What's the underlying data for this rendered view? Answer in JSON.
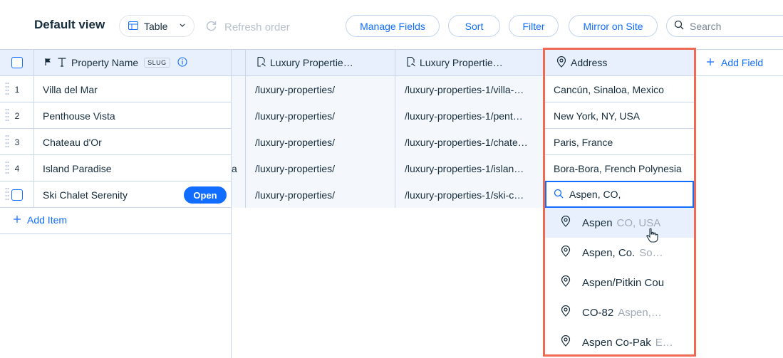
{
  "toolbar": {
    "title": "Default view",
    "view_select": "Table",
    "refresh": "Refresh order",
    "manage_fields": "Manage Fields",
    "sort": "Sort",
    "filter": "Filter",
    "mirror": "Mirror on Site",
    "search_placeholder": "Search"
  },
  "columns": {
    "property_name": "Property Name",
    "slug_badge": "SLUG",
    "luxury1": "Luxury Propertie…",
    "luxury2": "Luxury Propertie…",
    "address": "Address",
    "add_field": "Add Field"
  },
  "rows": [
    {
      "num": "1",
      "name": "Villa del Mar",
      "link1": "/luxury-properties/",
      "link2": "/luxury-properties-1/villa-…",
      "address": "Cancún, Sinaloa, Mexico"
    },
    {
      "num": "2",
      "name": "Penthouse Vista",
      "link1": "/luxury-properties/",
      "link2": "/luxury-properties-1/pent…",
      "address": "New York, NY, USA"
    },
    {
      "num": "3",
      "name": "Chateau d'Or",
      "link1": "/luxury-properties/",
      "link2": "/luxury-properties-1/chate…",
      "address": "Paris, France"
    },
    {
      "num": "4",
      "name": "Island Paradise",
      "link1": "/luxury-properties/",
      "link2": "/luxury-properties-1/islan…",
      "address": "Bora-Bora, French Polynesia",
      "fragment": "a"
    },
    {
      "name": "Ski Chalet Serenity",
      "link1": "/luxury-properties/",
      "link2": "/luxury-properties-1/ski-c…",
      "open": "Open"
    }
  ],
  "add_item": "Add Item",
  "address_input": "Aspen, CO,",
  "suggestions": [
    {
      "main": "Aspen",
      "sub": "CO, USA"
    },
    {
      "main": "Aspen, Co.",
      "sub": "So…"
    },
    {
      "main": "Aspen/Pitkin Cou",
      "sub": ""
    },
    {
      "main": "CO-82",
      "sub": "Aspen,…"
    },
    {
      "main": "Aspen Co-Pak",
      "sub": "E…"
    }
  ],
  "colors": {
    "accent": "#116dff",
    "highlight": "#ef6a52",
    "header_bg": "#e8f0fd"
  }
}
